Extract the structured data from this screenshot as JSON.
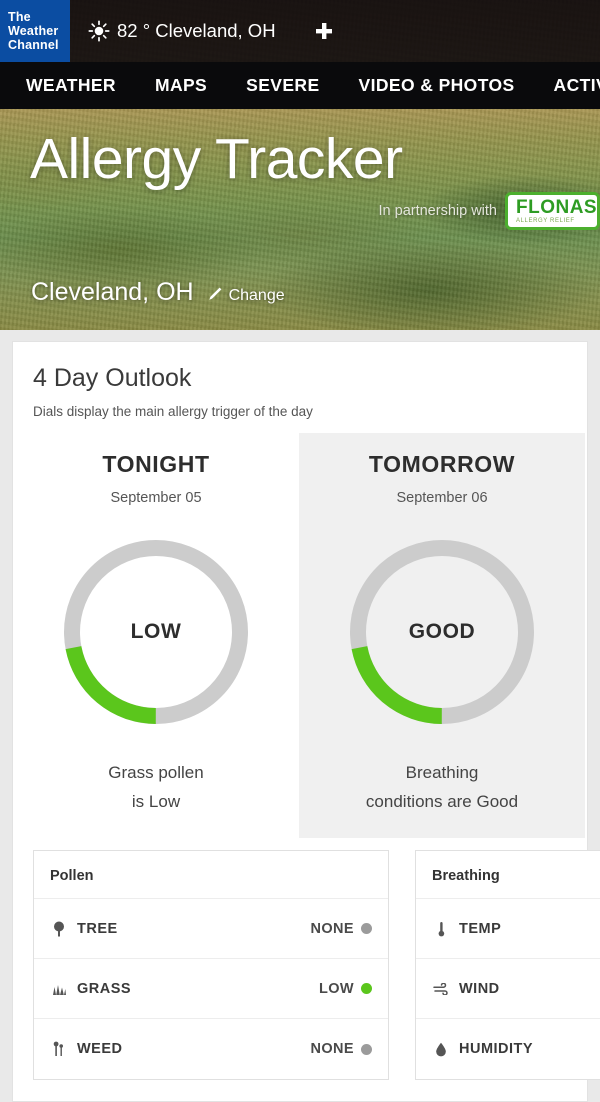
{
  "topbar": {
    "logo_line1": "The",
    "logo_line2": "Weather",
    "logo_line3": "Channel",
    "sun_icon": "sun-icon",
    "temperature": "82 ° Cleveland, OH",
    "add_icon": "plus-icon"
  },
  "nav": {
    "items": [
      {
        "label": "WEATHER"
      },
      {
        "label": "MAPS"
      },
      {
        "label": "SEVERE"
      },
      {
        "label": "VIDEO & PHOTOS"
      },
      {
        "label": "ACTIVITIES"
      }
    ]
  },
  "hero": {
    "title": "Allergy Tracker",
    "partnership_text": "In partnership with",
    "partner_brand": "FLONASE",
    "partner_tagline": "ALLERGY RELIEF",
    "location": "Cleveland, OH",
    "change_label": "Change",
    "change_icon": "pencil-icon"
  },
  "outlook": {
    "title": "4 Day Outlook",
    "subtitle": "Dials display the main allergy trigger of the day",
    "cards": [
      {
        "day": "TONIGHT",
        "date": "September 05",
        "dial_label": "LOW",
        "dial_percent": 22,
        "dial_color": "#5bc61c",
        "track_color": "#cccccc",
        "description_line1": "Grass pollen",
        "description_line2": "is Low",
        "selected": false
      },
      {
        "day": "TOMORROW",
        "date": "September 06",
        "dial_label": "GOOD",
        "dial_percent": 22,
        "dial_color": "#5bc61c",
        "track_color": "#cccccc",
        "description_line1": "Breathing",
        "description_line2": "conditions are Good",
        "selected": true
      }
    ]
  },
  "detail_tables": [
    {
      "title": "Pollen",
      "rows": [
        {
          "icon": "tree-icon",
          "label": "TREE",
          "value": "NONE",
          "dot_color": "#9b9b9b"
        },
        {
          "icon": "grass-icon",
          "label": "GRASS",
          "value": "LOW",
          "dot_color": "#5bc61c"
        },
        {
          "icon": "weed-icon",
          "label": "WEED",
          "value": "NONE",
          "dot_color": "#9b9b9b"
        }
      ]
    },
    {
      "title": "Breathing",
      "rows": [
        {
          "icon": "thermometer-icon",
          "label": "TEMP",
          "value": "",
          "dot_color": ""
        },
        {
          "icon": "wind-icon",
          "label": "WIND",
          "value": "",
          "dot_color": ""
        },
        {
          "icon": "droplet-icon",
          "label": "HUMIDITY",
          "value": "",
          "dot_color": ""
        }
      ]
    }
  ],
  "colors": {
    "brand_blue": "#0b4da2",
    "accent_green": "#5bc61c",
    "neutral_gray": "#9b9b9b",
    "topbar_bg": "#08080a",
    "page_bg": "#e9e9e9"
  }
}
